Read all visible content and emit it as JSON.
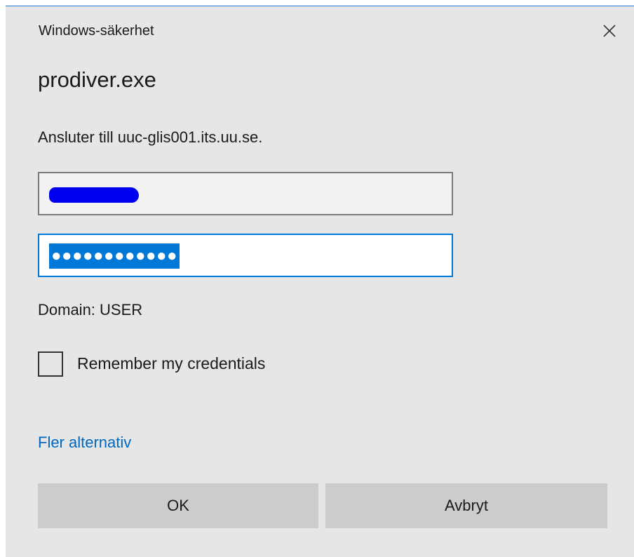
{
  "dialog": {
    "window_title": "Windows-säkerhet",
    "app_name": "prodiver.exe",
    "connect_message": "Ansluter till uuc-glis001.its.uu.se.",
    "username": {
      "value": ""
    },
    "password": {
      "masked_value": "●●●●●●●●●●●●"
    },
    "domain_text": "Domain: USER",
    "remember": {
      "label": "Remember my credentials",
      "checked": false
    },
    "more_options_link": "Fler alternativ",
    "ok_label": "OK",
    "cancel_label": "Avbryt",
    "icons": {
      "close": "close-icon"
    },
    "colors": {
      "accent": "#0078d7",
      "link": "#0067c0",
      "background": "#e6e6e6",
      "button": "#cccccc",
      "redaction": "#0000ee"
    }
  }
}
